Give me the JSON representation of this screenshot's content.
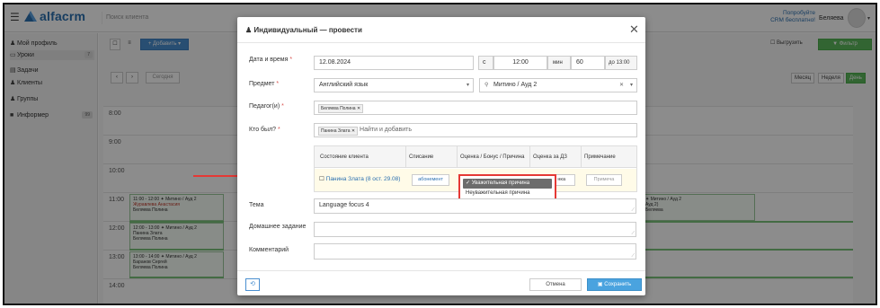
{
  "topbar": {
    "logo": "alfacrm",
    "search_placeholder": "Поиск клиента",
    "promo_line1": "Попробуйте",
    "promo_line2": "CRM бесплатно!",
    "username": "Беляева"
  },
  "sidebar": {
    "items": [
      {
        "label": "Мой профиль",
        "icon": "user-icon"
      },
      {
        "label": "Уроки",
        "icon": "calendar-icon",
        "badge": "7"
      },
      {
        "label": "Задачи",
        "icon": "tasks-icon"
      },
      {
        "label": "Клиенты",
        "icon": "user-icon"
      },
      {
        "label": "Группы",
        "icon": "group-icon"
      },
      {
        "label": "Информер",
        "icon": "info-icon",
        "badge": "99"
      }
    ]
  },
  "toolbar": {
    "add_label": "+ Добавить ▾",
    "filter_label": "▼ Фильтр",
    "issue_label": "Выгрузить"
  },
  "calendar": {
    "today_label": "Сегодня",
    "views": [
      "Месяц",
      "Неделя",
      "День"
    ],
    "active_view": "День",
    "times": [
      "8:00",
      "9:00",
      "10:00",
      "11:00",
      "12:00",
      "13:00",
      "14:00"
    ],
    "lessons": [
      {
        "time": "11:00 - 12:00 ✦ Митино / Ауд 2",
        "student": "Журавлева Анастасия",
        "teacher": "Беляева Полина"
      },
      {
        "time": "12:00 - 13:00 ✦ Митино / Ауд 2",
        "student": "Панина Злата",
        "teacher": "Беляева Полина"
      },
      {
        "time": "13:00 - 14:00 ✦ Митино / Ауд 2",
        "student": "Баранов Сергей",
        "teacher": "Беляева Полина"
      }
    ],
    "right_lesson": {
      "line1": "✦ Митино / Ауд 2",
      "line2": "Ауд 2)",
      "line3": "Беляева"
    }
  },
  "modal": {
    "title": "Индивидуальный — провести",
    "date_label": "Дата и время",
    "date_value": "12.08.2024",
    "from_label": "с",
    "time_from": "12:00",
    "min_label": "мин",
    "duration": "60",
    "to_label": "до 13:00",
    "subject_label": "Предмет",
    "subject_value": "Английский язык",
    "room_value": "Митино / Ауд 2",
    "teacher_label": "Педагог(и)",
    "teacher_tag": "Беляева Полина",
    "who_label": "Кто был?",
    "who_tag": "Панина Злата",
    "who_placeholder": "Найти и добавить",
    "table": {
      "headers": [
        "Состояние клиента",
        "Списание",
        "Оценка / Бонус / Причина",
        "Оценка за ДЗ",
        "Примечание"
      ],
      "client": "Панина Злата (8 ост. 29.08)",
      "writeoff": "абонемент",
      "hw_value": "нка",
      "note_placeholder": "Примеча"
    },
    "dropdown": {
      "options": [
        "Уважительная причина",
        "Неуважительная причина"
      ],
      "selected": "Уважительная причина"
    },
    "topic_label": "Тема",
    "topic_value": "Language focus 4",
    "homework_label": "Домашнее задание",
    "comment_label": "Комментарий",
    "cancel_label": "Отмена",
    "save_label": "Сохранить",
    "reset_label": "⟲"
  },
  "colors": {
    "accent": "#4aa3df",
    "green": "#5cb85c",
    "highlight": "#e53935"
  }
}
